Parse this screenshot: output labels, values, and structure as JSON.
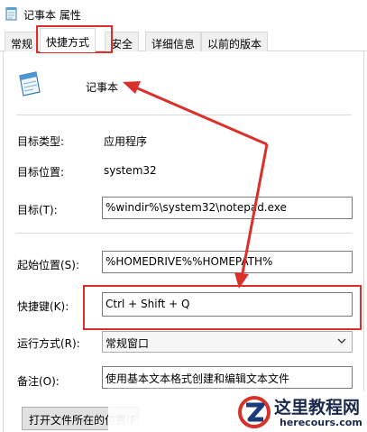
{
  "window": {
    "title": "记事本 属性"
  },
  "tabs": [
    {
      "label": "常规"
    },
    {
      "label": "快捷方式"
    },
    {
      "label": "安全"
    },
    {
      "label": "详细信息"
    },
    {
      "label": "以前的版本"
    }
  ],
  "active_tab": "快捷方式",
  "shortcut": {
    "name": "记事本",
    "target_type_label": "目标类型:",
    "target_type_value": "应用程序",
    "target_location_label": "目标位置:",
    "target_location_value": "system32",
    "target_label": "目标(T):",
    "target_value": "%windir%\\system32\\notepad.exe",
    "start_in_label": "起始位置(S):",
    "start_in_value": "%HOMEDRIVE%%HOMEPATH%",
    "hotkey_label": "快捷键(K):",
    "hotkey_value": "Ctrl + Shift + Q",
    "run_label": "运行方式(R):",
    "run_value": "常规窗口",
    "comment_label": "备注(O):",
    "comment_value": "使用基本文本格式创建和编辑文本文件",
    "open_location_button": "打开文件所在的位置(F)"
  },
  "watermark": {
    "title": "这里教程网",
    "subtitle": "herecours.com"
  },
  "colors": {
    "highlight": "#d9302a",
    "field_border": "#7a7a7a",
    "tab_border": "#d9d9d9"
  },
  "icons": {
    "title": "notepad-icon",
    "app": "notepad-icon",
    "dropdown": "chevron-down-icon",
    "watermark": "z-logo-icon"
  }
}
